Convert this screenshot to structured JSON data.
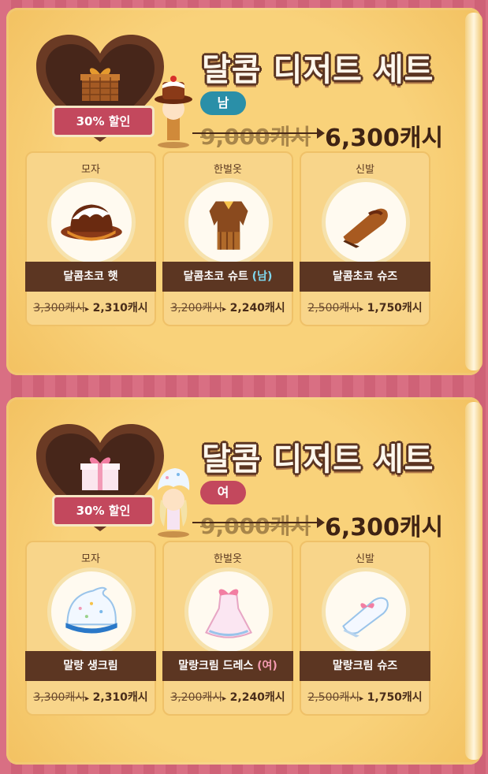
{
  "colors": {
    "background": "#d96f83",
    "card": "#f6c86a",
    "title_outline": "#5a3421",
    "male": "#2a8fa8",
    "female": "#c3485d",
    "name_bar": "#5c3622"
  },
  "sets": [
    {
      "title": "달콤 디저트 세트",
      "discount_badge": "30% 할인",
      "gender": "남",
      "gender_type": "male",
      "original_price": "9,000캐시",
      "sale_price": "6,300캐시",
      "gift_icon": "chocolate-gift-box-icon",
      "avatar_icon": "male-dessert-avatar-icon",
      "items": [
        {
          "category": "모자",
          "name": "달콤초코 햇",
          "gender_tag": "",
          "original": "3,300캐시",
          "arrow": "▸",
          "sale": "2,310캐시",
          "icon": "chocolate-hat-icon"
        },
        {
          "category": "한벌옷",
          "name": "달콤초코 슈트",
          "gender_tag": "(남)",
          "original": "3,200캐시",
          "arrow": "▸",
          "sale": "2,240캐시",
          "icon": "chocolate-suit-icon"
        },
        {
          "category": "신발",
          "name": "달콤초코 슈즈",
          "gender_tag": "",
          "original": "2,500캐시",
          "arrow": "▸",
          "sale": "1,750캐시",
          "icon": "chocolate-shoes-icon"
        }
      ]
    },
    {
      "title": "달콤 디저트 세트",
      "discount_badge": "30% 할인",
      "gender": "여",
      "gender_type": "female",
      "original_price": "9,000캐시",
      "sale_price": "6,300캐시",
      "gift_icon": "pink-gift-box-icon",
      "avatar_icon": "female-cream-avatar-icon",
      "items": [
        {
          "category": "모자",
          "name": "말랑 생크림",
          "gender_tag": "",
          "original": "3,300캐시",
          "arrow": "▸",
          "sale": "2,310캐시",
          "icon": "whipped-cream-hat-icon"
        },
        {
          "category": "한벌옷",
          "name": "말랑크림 드레스",
          "gender_tag": "(여)",
          "original": "3,200캐시",
          "arrow": "▸",
          "sale": "2,240캐시",
          "icon": "cream-dress-icon"
        },
        {
          "category": "신발",
          "name": "말랑크림 슈즈",
          "gender_tag": "",
          "original": "2,500캐시",
          "arrow": "▸",
          "sale": "1,750캐시",
          "icon": "cream-shoes-icon"
        }
      ]
    }
  ]
}
